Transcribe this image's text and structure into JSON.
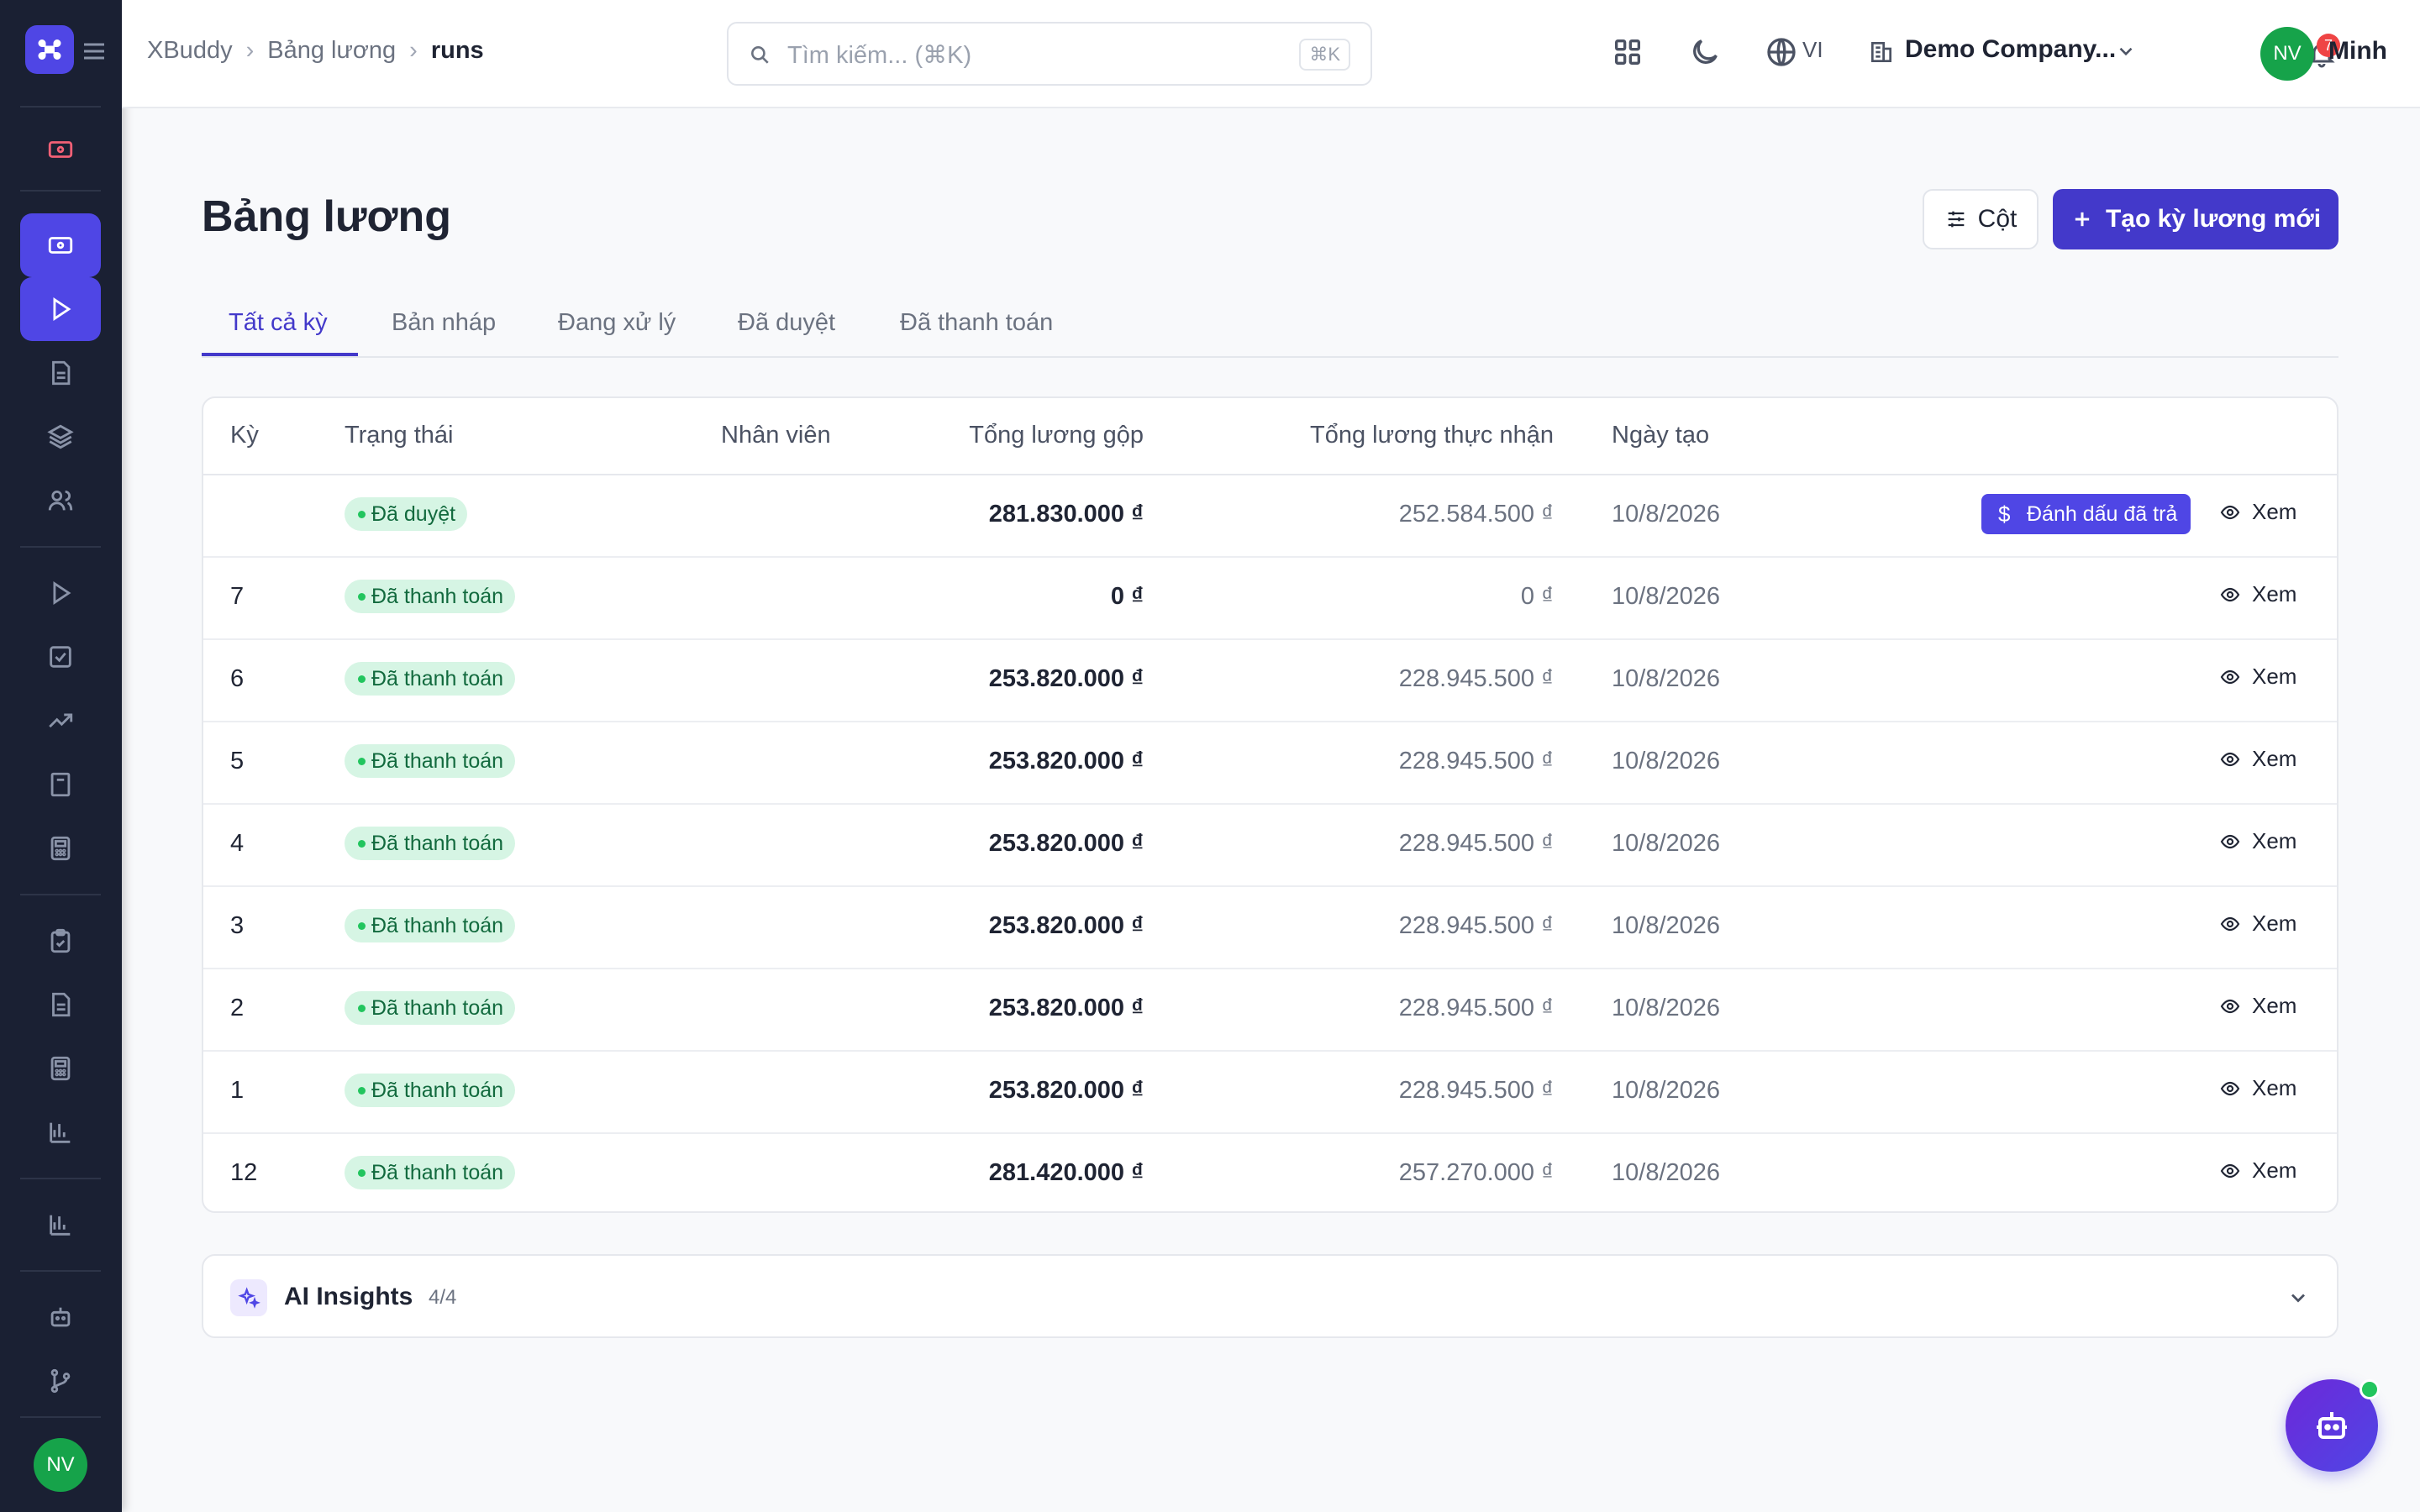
{
  "header": {
    "breadcrumbs": [
      "XBuddy",
      "Bảng lương",
      "runs"
    ],
    "search_placeholder": "Tìm kiếm... (⌘K)",
    "search_shortcut": "⌘K",
    "language": "VI",
    "company": "Demo Company...",
    "notification_count": "7",
    "user_initials": "NV",
    "user_name": "Minh"
  },
  "sidebar": {
    "user_initials": "NV",
    "icons": [
      "money-icon",
      "money-icon",
      "play-icon",
      "file-icon",
      "layers-icon",
      "users-icon",
      "play-icon",
      "check-square-icon",
      "trending-up-icon",
      "book-icon",
      "calculator-icon",
      "clipboard-icon",
      "file-icon",
      "calculator-icon",
      "bar-chart-icon",
      "bar-chart-icon",
      "bot-icon",
      "git-branch-icon"
    ]
  },
  "page": {
    "title": "Bảng lương",
    "columns_button": "Cột",
    "new_button": "Tạo kỳ lương mới"
  },
  "tabs": [
    "Tất cả kỳ",
    "Bản nháp",
    "Đang xử lý",
    "Đã duyệt",
    "Đã thanh toán"
  ],
  "table": {
    "headers": [
      "Kỳ",
      "Trạng thái",
      "Nhân viên",
      "Tổng lương gộp",
      "Tổng lương thực nhận",
      "Ngày tạo"
    ],
    "mark_paid_label": "Đánh dấu đã trả",
    "view_label": "Xem",
    "rows": [
      {
        "ky": "",
        "status": "Đã duyệt",
        "gross": "281.830.000 ₫",
        "net": "252.584.500 ₫",
        "date": "10/8/2026"
      },
      {
        "ky": "7",
        "status": "Đã thanh toán",
        "gross": "0 ₫",
        "net": "0 ₫",
        "date": "10/8/2026"
      },
      {
        "ky": "6",
        "status": "Đã thanh toán",
        "gross": "253.820.000 ₫",
        "net": "228.945.500 ₫",
        "date": "10/8/2026"
      },
      {
        "ky": "5",
        "status": "Đã thanh toán",
        "gross": "253.820.000 ₫",
        "net": "228.945.500 ₫",
        "date": "10/8/2026"
      },
      {
        "ky": "4",
        "status": "Đã thanh toán",
        "gross": "253.820.000 ₫",
        "net": "228.945.500 ₫",
        "date": "10/8/2026"
      },
      {
        "ky": "3",
        "status": "Đã thanh toán",
        "gross": "253.820.000 ₫",
        "net": "228.945.500 ₫",
        "date": "10/8/2026"
      },
      {
        "ky": "2",
        "status": "Đã thanh toán",
        "gross": "253.820.000 ₫",
        "net": "228.945.500 ₫",
        "date": "10/8/2026"
      },
      {
        "ky": "1",
        "status": "Đã thanh toán",
        "gross": "253.820.000 ₫",
        "net": "228.945.500 ₫",
        "date": "10/8/2026"
      },
      {
        "ky": "12",
        "status": "Đã thanh toán",
        "gross": "281.420.000 ₫",
        "net": "257.270.000 ₫",
        "date": "10/8/2026"
      }
    ]
  },
  "insights": {
    "title": "AI Insights",
    "count": "4/4"
  },
  "colors": {
    "primary": "#4339ca",
    "sidebar_bg": "#1a2033",
    "status_bg": "#d6f5e4",
    "status_text": "#126a3e",
    "avatar": "#16a34a"
  }
}
